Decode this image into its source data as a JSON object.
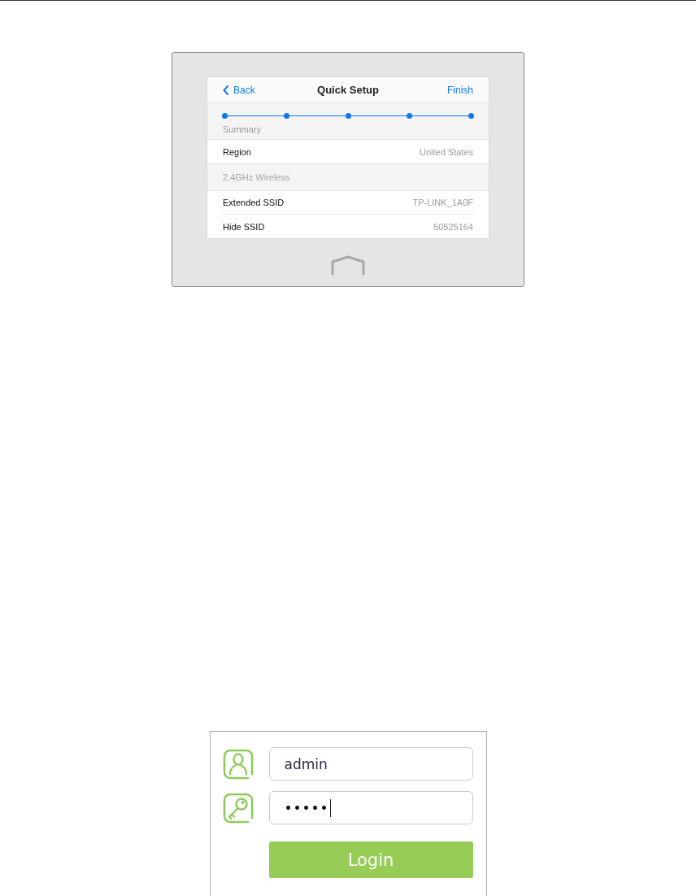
{
  "device_screen": {
    "header": {
      "back_label": "Back",
      "title": "Quick Setup",
      "finish_label": "Finish"
    },
    "progress": {
      "steps": [
        {
          "done": true
        },
        {
          "done": true
        },
        {
          "done": true
        },
        {
          "done": true
        },
        {
          "done": true
        }
      ],
      "label": "Summary"
    },
    "rows": [
      {
        "kind": "item",
        "label": "Region",
        "value": "United States"
      },
      {
        "kind": "section",
        "label": "2.4GHz Wireless"
      },
      {
        "kind": "item",
        "label": "Extended SSID",
        "value": "TP-LINK_1A0F"
      },
      {
        "kind": "item",
        "label": "Hide SSID",
        "value": "50525164"
      }
    ]
  },
  "login": {
    "fields": [
      {
        "kind": "username",
        "value": "admin",
        "focused": false
      },
      {
        "kind": "password",
        "value": "•••••",
        "focused": true
      }
    ],
    "button": "Login"
  }
}
